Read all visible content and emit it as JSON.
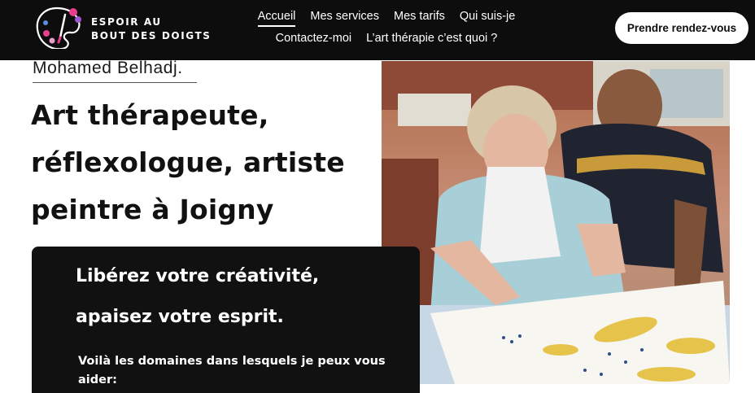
{
  "brand": {
    "line1": "ESPOIR AU",
    "line2": "BOUT DES DOIGTS"
  },
  "nav": {
    "row1": [
      "Accueil",
      "Mes services",
      "Mes tarifs",
      "Qui suis-je"
    ],
    "row2": [
      "Contactez-moi",
      "L’art thérapie c’est quoi ?"
    ],
    "active": "Accueil"
  },
  "cta": {
    "label": "Prendre rendez-vous"
  },
  "hero": {
    "subtitle": "Mohamed Belhadj.",
    "headline_lines": [
      "Art thérapeute,",
      "réflexologue, artiste",
      "peintre à Joigny"
    ]
  },
  "card": {
    "title_line1": "Libérez votre créativité,",
    "title_line2": "apaisez votre esprit.",
    "text": "Voilà les domaines dans lesquels je peux vous aider:"
  },
  "colors": {
    "header_bg": "#0d0d0d",
    "card_bg": "#111111",
    "text": "#111111"
  }
}
